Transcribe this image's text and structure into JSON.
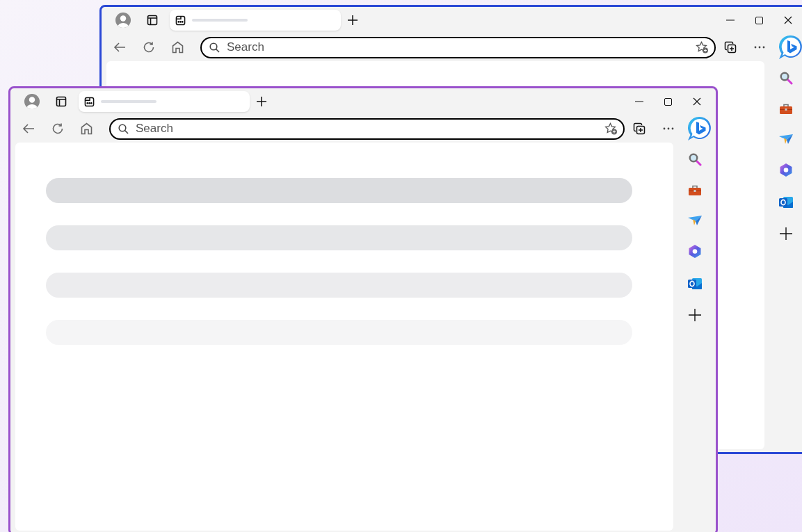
{
  "windows": [
    {
      "color": "#2a48d6",
      "search": {
        "placeholder": "Search"
      }
    },
    {
      "color": "#9a52cc",
      "search": {
        "placeholder": "Search"
      }
    }
  ]
}
